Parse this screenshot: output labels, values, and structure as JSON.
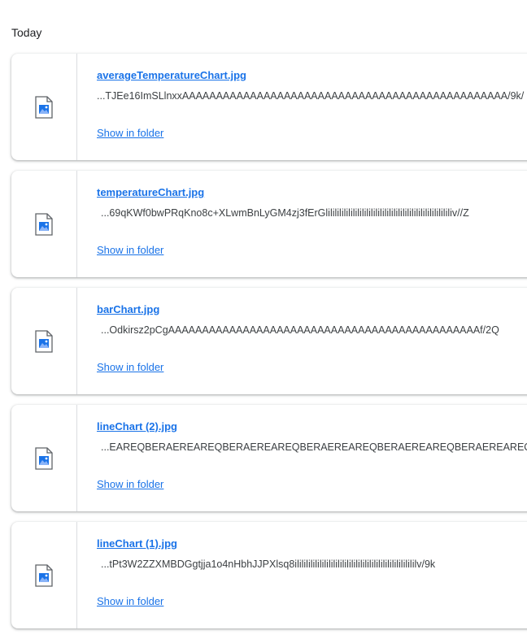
{
  "section": {
    "date_label": "Today"
  },
  "downloads": [
    {
      "name": "averageTemperatureChart.jpg",
      "url": "...TJEe16ImSLlnxxAAAAAAAAAAAAAAAAAAAAAAAAAAAAAAAAAAAAAAAAAAAAAAAA/9k/",
      "action": "Show in folder",
      "icon": "image-file-icon"
    },
    {
      "name": "temperatureChart.jpg",
      "url": "...69qKWf0bwPRqKno8c+XLwmBnLyGM4zj3fErGlilililililililililililililililililililililililililililiv//Z",
      "action": "Show in folder",
      "icon": "image-file-icon"
    },
    {
      "name": "barChart.jpg",
      "url": "...Odkirsz2pCgAAAAAAAAAAAAAAAAAAAAAAAAAAAAAAAAAAAAAAAAAAAAAAf/2Q",
      "action": "Show in folder",
      "icon": "image-file-icon"
    },
    {
      "name": "lineChart (2).jpg",
      "url": "...EAREQBERAEREAREQBERAEREAREQBERAEREAREQBERAEREAREQBERAEREAREQH//Z",
      "action": "Show in folder",
      "icon": "image-file-icon"
    },
    {
      "name": "lineChart (1).jpg",
      "url": "...tPt3W2ZZXMBDGgtjja1o4nHbhJJPXlsq8ilililililililililililililililililililililililililililv/9k",
      "action": "Show in folder",
      "icon": "image-file-icon"
    }
  ]
}
